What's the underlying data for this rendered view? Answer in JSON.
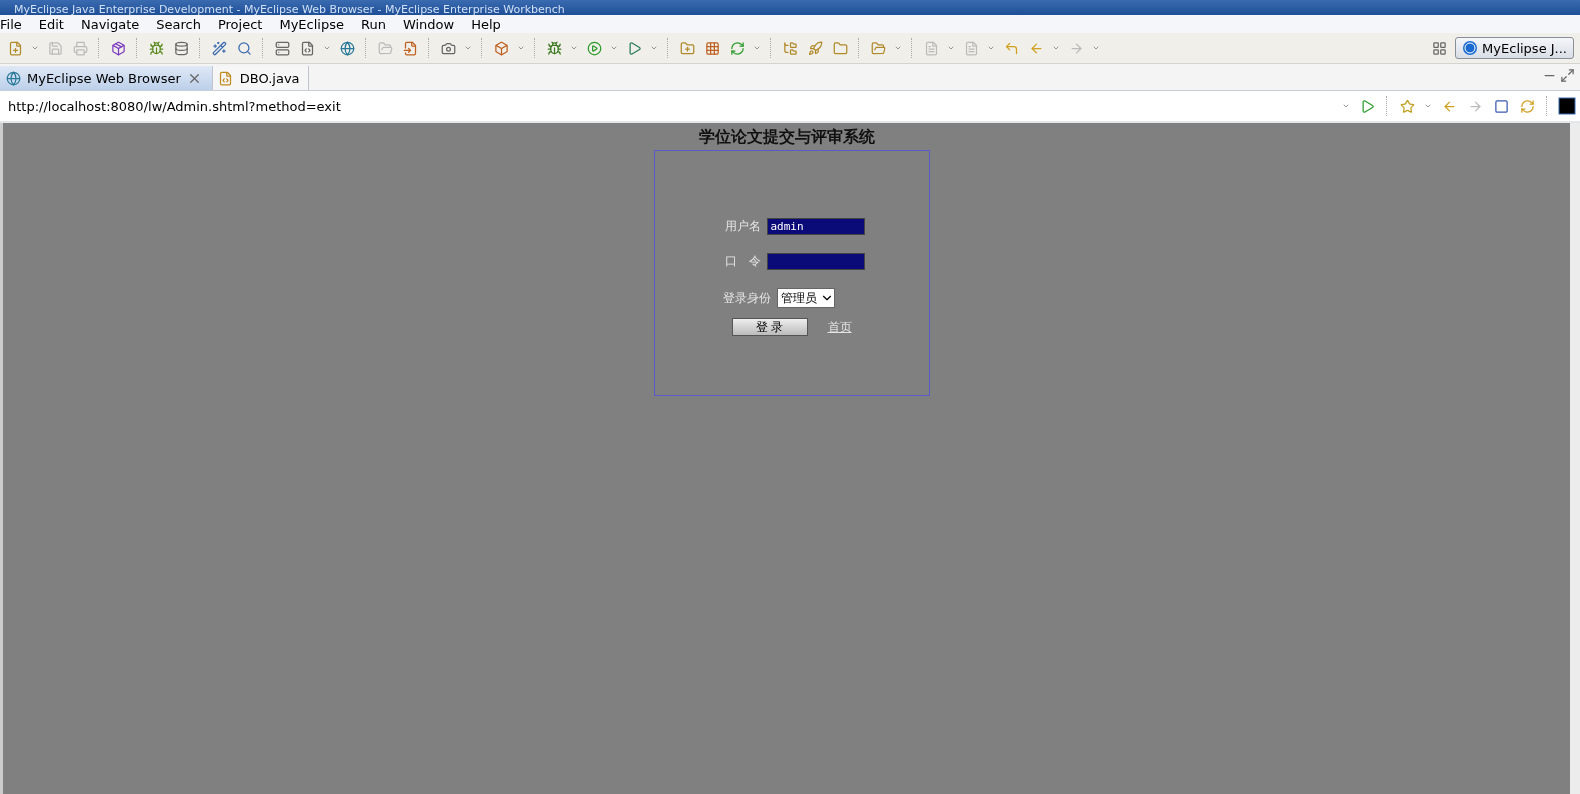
{
  "window": {
    "title": "MyEclipse Java Enterprise Development - MyEclipse Web Browser - MyEclipse Enterprise Workbench"
  },
  "menu": [
    "File",
    "Edit",
    "Navigate",
    "Search",
    "Project",
    "MyEclipse",
    "Run",
    "Window",
    "Help"
  ],
  "perspective": {
    "label": "MyEclipse J..."
  },
  "tabs": [
    {
      "label": "MyEclipse Web Browser",
      "selected": true,
      "closable": true
    },
    {
      "label": "DBO.java",
      "selected": false,
      "closable": false
    }
  ],
  "address": {
    "value": "http://localhost:8080/lw/Admin.shtml?method=exit"
  },
  "page": {
    "heading": "学位论文提交与评审系统",
    "username": {
      "label": "用户名",
      "value": "admin"
    },
    "password": {
      "label": "口　令"
    },
    "role": {
      "label": "登录身份",
      "value": "管理员"
    },
    "login_button": "登 录",
    "home_link": "首页"
  }
}
